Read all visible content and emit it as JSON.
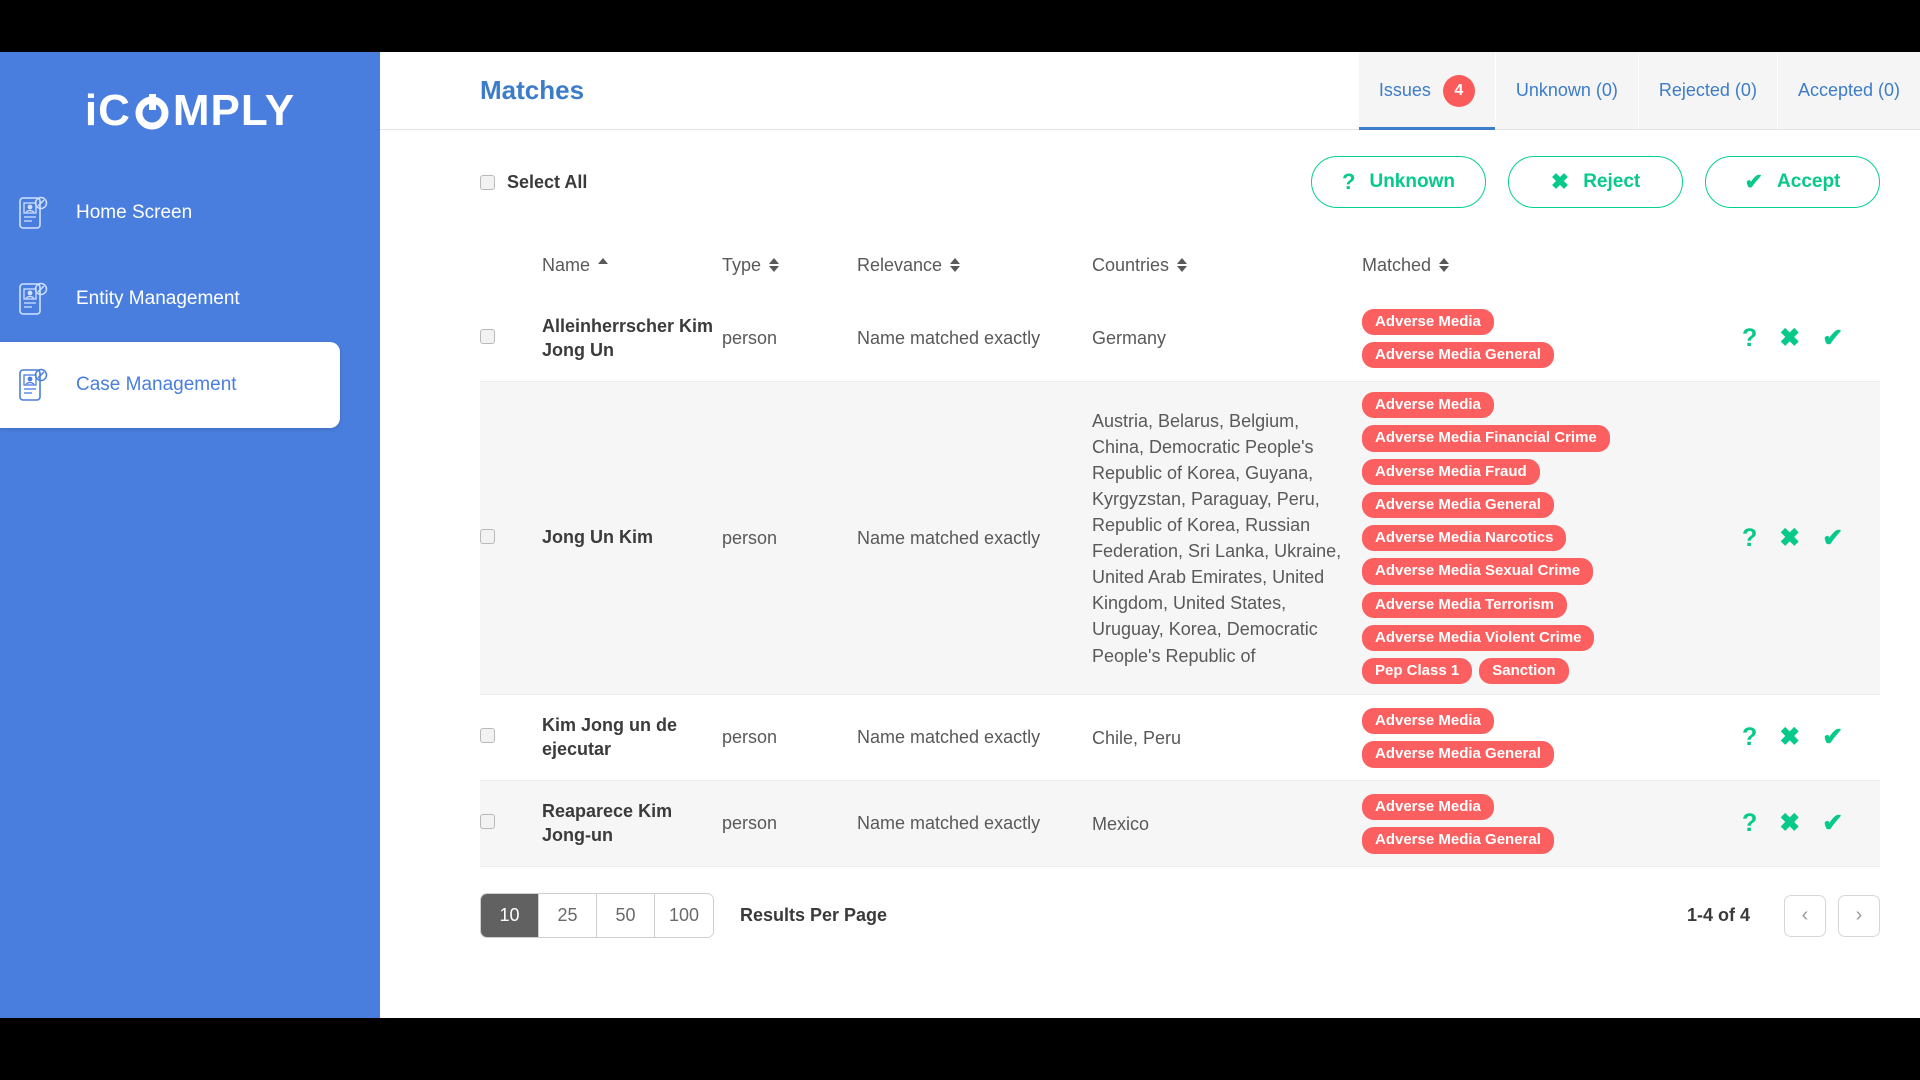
{
  "brand": {
    "name_part1": "i",
    "name_part2": "C",
    "name_part3": "MPLY",
    "bg_color": "#4a7ede"
  },
  "sidebar": {
    "items": [
      {
        "label": "Home Screen",
        "icon": "mobile-id-icon",
        "active": false
      },
      {
        "label": "Entity Management",
        "icon": "mobile-id-icon",
        "active": false
      },
      {
        "label": "Case Management",
        "icon": "mobile-id-icon",
        "active": true
      }
    ]
  },
  "header": {
    "title": "Matches",
    "tabs": [
      {
        "label": "Issues",
        "badge": "4",
        "active": true
      },
      {
        "label": "Unknown (0)",
        "badge": null,
        "active": false
      },
      {
        "label": "Rejected (0)",
        "badge": null,
        "active": false
      },
      {
        "label": "Accepted (0)",
        "badge": null,
        "active": false
      }
    ]
  },
  "toolbar": {
    "select_all_label": "Select All",
    "buttons": [
      {
        "label": "Unknown",
        "icon": "question-mark-icon",
        "glyph": "?"
      },
      {
        "label": "Reject",
        "icon": "cross-icon",
        "glyph": "✖"
      },
      {
        "label": "Accept",
        "icon": "check-icon",
        "glyph": "✔"
      }
    ]
  },
  "table": {
    "columns": [
      {
        "label": "Name",
        "sort": "asc"
      },
      {
        "label": "Type",
        "sort": "none"
      },
      {
        "label": "Relevance",
        "sort": "none"
      },
      {
        "label": "Countries",
        "sort": "none"
      },
      {
        "label": "Matched",
        "sort": "none"
      }
    ],
    "rows": [
      {
        "name": "Alleinherrscher Kim Jong Un",
        "type": "person",
        "relevance": "Name matched exactly",
        "countries": "Germany",
        "matched": [
          "Adverse Media",
          "Adverse Media General"
        ]
      },
      {
        "name": "Jong Un Kim",
        "type": "person",
        "relevance": "Name matched exactly",
        "countries": "Austria, Belarus, Belgium, China, Democratic People's Republic of Korea, Guyana, Kyrgyzstan, Paraguay, Peru, Republic of Korea, Russian Federation, Sri Lanka, Ukraine, United Arab Emirates, United Kingdom, United States, Uruguay, Korea, Democratic People's Republic of",
        "matched": [
          "Adverse Media",
          "Adverse Media Financial Crime",
          "Adverse Media Fraud",
          "Adverse Media General",
          "Adverse Media Narcotics",
          "Adverse Media Sexual Crime",
          "Adverse Media Terrorism",
          "Adverse Media Violent Crime",
          "Pep Class 1",
          "Sanction"
        ]
      },
      {
        "name": "Kim Jong un de ejecutar",
        "type": "person",
        "relevance": "Name matched exactly",
        "countries": "Chile, Peru",
        "matched": [
          "Adverse Media",
          "Adverse Media General"
        ]
      },
      {
        "name": "Reaparece Kim Jong-un",
        "type": "person",
        "relevance": "Name matched exactly",
        "countries": "Mexico",
        "matched": [
          "Adverse Media",
          "Adverse Media General"
        ]
      }
    ],
    "row_actions": [
      {
        "icon": "question-mark-icon",
        "glyph": "?"
      },
      {
        "icon": "cross-icon",
        "glyph": "✖"
      },
      {
        "icon": "check-icon",
        "glyph": "✔"
      }
    ]
  },
  "footer": {
    "page_sizes": [
      "10",
      "25",
      "50",
      "100"
    ],
    "selected_page_size": "10",
    "results_per_page_label": "Results Per Page",
    "range_label": "1-4 of 4",
    "prev_glyph": "‹",
    "next_glyph": "›"
  },
  "colors": {
    "brand_blue": "#4a7ede",
    "link_blue": "#3d7cc9",
    "accent_green": "#06c98a",
    "tag_red": "#fb5f5f"
  }
}
